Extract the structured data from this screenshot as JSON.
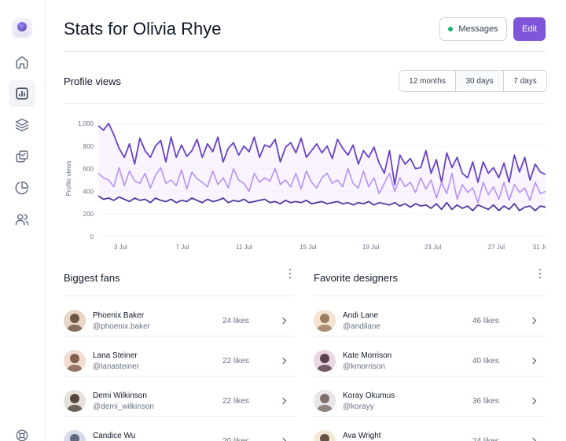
{
  "header": {
    "title": "Stats for Olivia Rhye",
    "messages_label": "Messages",
    "edit_label": "Edit"
  },
  "sidebar": {
    "items": [
      {
        "icon": "home-icon",
        "active": false
      },
      {
        "icon": "bar-chart-icon",
        "active": true
      },
      {
        "icon": "layers-icon",
        "active": false
      },
      {
        "icon": "check-squares-icon",
        "active": false
      },
      {
        "icon": "pie-chart-icon",
        "active": false
      },
      {
        "icon": "users-icon",
        "active": false
      }
    ],
    "footer_icon": "life-buoy-icon"
  },
  "profile_views": {
    "title": "Profile views",
    "ranges": [
      "12 months",
      "30 days",
      "7 days"
    ],
    "selected_range": "30 days"
  },
  "chart_data": {
    "type": "line",
    "ylabel": "Profile views",
    "ylim": [
      0,
      1000
    ],
    "yticks": [
      "0",
      "200",
      "400",
      "600",
      "800",
      "1,000"
    ],
    "xticks": [
      "3 Jul",
      "7 Jul",
      "11 Jul",
      "15 Jul",
      "19 Jul",
      "23 Jul",
      "27 Jul",
      "31 Jul"
    ],
    "colors": [
      "#6941c6",
      "#b692f6",
      "#53389e"
    ],
    "series": [
      {
        "values": [
          980,
          940,
          1000,
          900,
          780,
          700,
          820,
          640,
          870,
          760,
          700,
          800,
          850,
          660,
          880,
          700,
          810,
          710,
          760,
          860,
          700,
          820,
          750,
          880,
          660,
          780,
          830,
          720,
          800,
          750,
          880,
          700,
          810,
          790,
          860,
          660,
          790,
          830,
          740,
          870,
          700,
          760,
          820,
          740,
          800,
          690,
          860,
          780,
          720,
          810,
          640,
          760,
          700,
          790,
          650,
          560,
          760,
          460,
          720,
          640,
          690,
          600,
          610,
          760,
          560,
          680,
          480,
          740,
          610,
          700,
          560,
          520,
          660,
          480,
          660,
          560,
          610,
          520,
          650,
          480,
          720,
          570,
          700,
          500,
          640,
          570,
          550
        ]
      },
      {
        "values": [
          560,
          520,
          500,
          440,
          610,
          450,
          580,
          490,
          470,
          560,
          430,
          540,
          610,
          470,
          500,
          450,
          590,
          420,
          570,
          510,
          480,
          440,
          580,
          460,
          520,
          430,
          600,
          500,
          470,
          400,
          560,
          480,
          520,
          490,
          600,
          460,
          500,
          440,
          560,
          420,
          580,
          480,
          430,
          520,
          560,
          470,
          500,
          440,
          600,
          470,
          430,
          580,
          440,
          520,
          380,
          470,
          560,
          400,
          520,
          440,
          480,
          390,
          520,
          420,
          500,
          340,
          480,
          380,
          560,
          330,
          460,
          390,
          430,
          300,
          480,
          370,
          440,
          330,
          480,
          320,
          460,
          390,
          430,
          320,
          480,
          380,
          400
        ]
      },
      {
        "values": [
          360,
          330,
          340,
          320,
          350,
          330,
          310,
          340,
          320,
          330,
          300,
          340,
          320,
          310,
          330,
          300,
          320,
          310,
          340,
          320,
          300,
          330,
          310,
          320,
          340,
          300,
          320,
          310,
          330,
          300,
          310,
          320,
          330,
          300,
          310,
          290,
          320,
          300,
          310,
          300,
          320,
          290,
          300,
          310,
          290,
          300,
          310,
          290,
          300,
          280,
          300,
          290,
          310,
          280,
          300,
          290,
          280,
          300,
          270,
          290,
          260,
          290,
          270,
          280,
          250,
          290,
          240,
          300,
          240,
          280,
          250,
          270,
          230,
          280,
          260,
          240,
          280,
          230,
          270,
          240,
          290,
          230,
          260,
          270,
          230,
          270,
          260
        ]
      }
    ]
  },
  "fans": {
    "title": "Biggest fans",
    "items": [
      {
        "name": "Phoenix Baker",
        "handle": "@phoenix.baker",
        "likes": "24 likes"
      },
      {
        "name": "Lana Steiner",
        "handle": "@lanasteiner",
        "likes": "22 likes"
      },
      {
        "name": "Demi Wilkinson",
        "handle": "@demi_wilkinson",
        "likes": "22 likes"
      },
      {
        "name": "Candice Wu",
        "handle": "",
        "likes": "20 likes"
      }
    ]
  },
  "designers": {
    "title": "Favorite designers",
    "items": [
      {
        "name": "Andi Lane",
        "handle": "@andilane",
        "likes": "46 likes"
      },
      {
        "name": "Kate Morrison",
        "handle": "@kmorrison",
        "likes": "40 likes"
      },
      {
        "name": "Koray Okumus",
        "handle": "@korayy",
        "likes": "36 likes"
      },
      {
        "name": "Ava Wright",
        "handle": "",
        "likes": "24 likes"
      }
    ]
  }
}
